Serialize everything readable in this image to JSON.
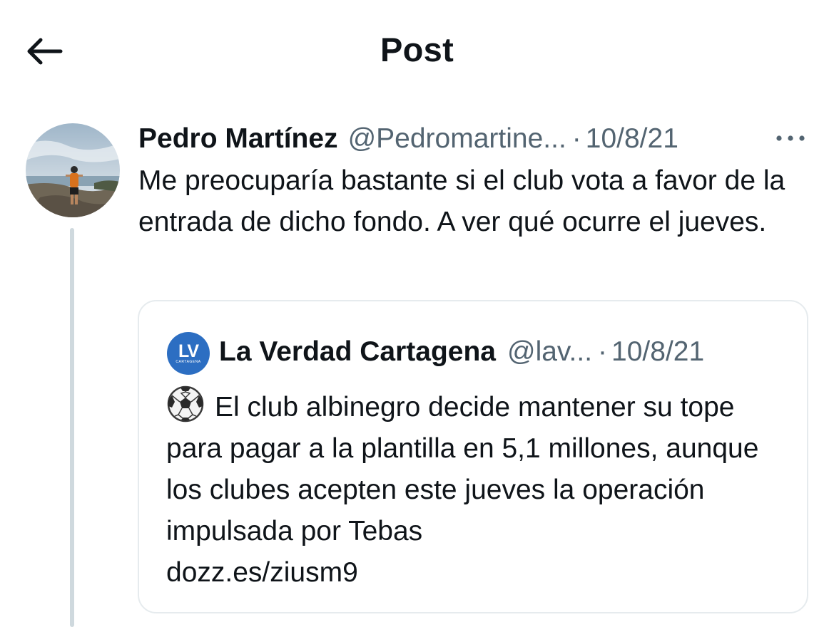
{
  "header": {
    "title": "Post",
    "back_icon": "arrow-left-icon"
  },
  "post": {
    "author_name": "Pedro Martínez",
    "author_handle": "@Pedromartine...",
    "separator": "·",
    "date": "10/8/21",
    "more_icon": "more-horizontal-icon",
    "text": "Me preocuparía bastante si el club vota a favor de la entrada de dicho fondo. A ver qué ocurre el jueves.",
    "avatar_icon": "user-avatar-photo"
  },
  "quote": {
    "logo_text": "LV",
    "logo_subtext": "CARTAGENA",
    "author_name": "La Verdad Cartagena",
    "author_handle": "@lav...",
    "separator": "·",
    "date": "10/8/21",
    "emoji_icon": "soccer-ball-icon",
    "text": "El club albinegro decide mantener su tope para pagar a la plantilla en 5,1 millones, aunque los clubes acepten este jueves la operación impulsada por Tebas",
    "link": "dozz.es/ziusm9"
  },
  "colors": {
    "text_primary": "#0f1419",
    "text_secondary": "#536471",
    "border": "#e6ebee",
    "thread_line": "#cfd9de",
    "brand_blue": "#2c6ec2"
  }
}
